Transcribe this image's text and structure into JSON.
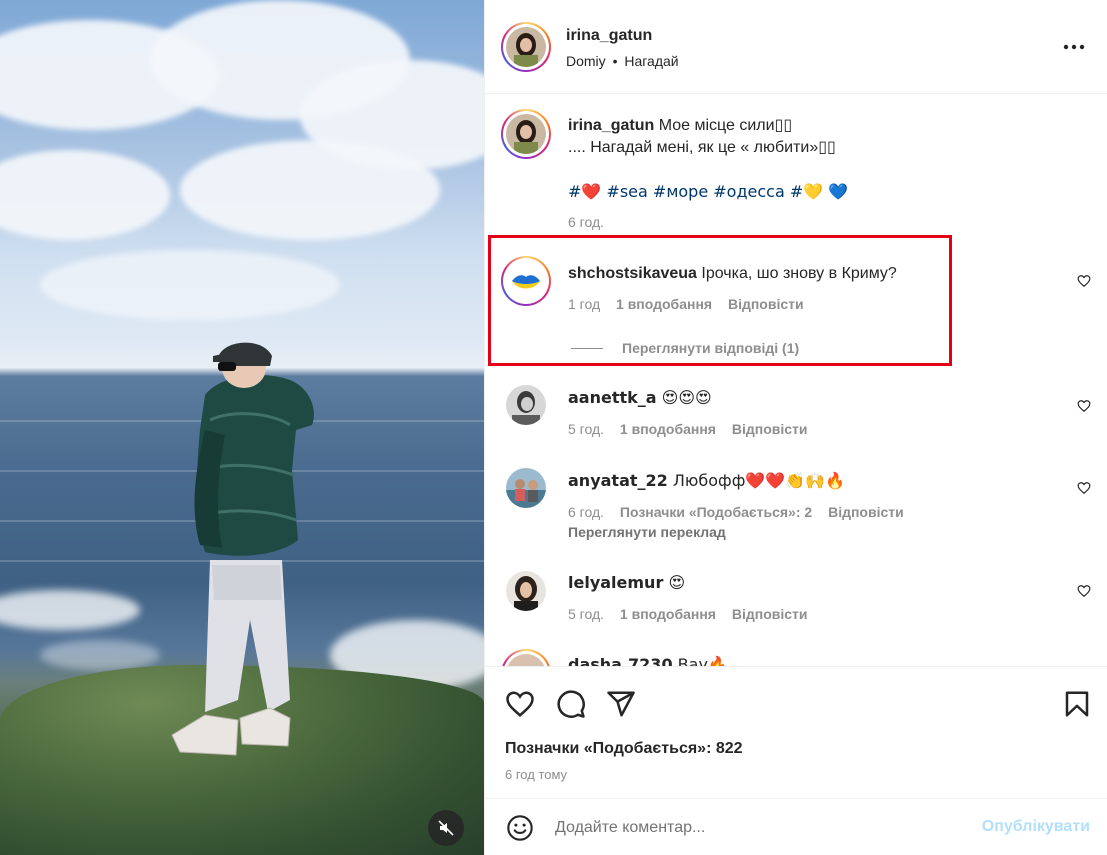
{
  "post": {
    "author": "irina_gatun",
    "location": "Domiy",
    "follow_action": "Нагадай",
    "separator": "•"
  },
  "caption": {
    "author": "irina_gatun",
    "line1": "Мое місце сили▯▯",
    "line2": ".... Нагадай мені, як це « любити»▯▯",
    "hashtags": [
      {
        "text": "#❤️",
        "id": "hash-heart"
      },
      {
        "text": "#sea",
        "id": "hash-sea"
      },
      {
        "text": "#море",
        "id": "hash-more"
      },
      {
        "text": "#одесса",
        "id": "hash-odessa"
      },
      {
        "text": "#💛 💙",
        "id": "hash-flag"
      }
    ],
    "time": "6 год."
  },
  "comments": [
    {
      "user": "shchostsikaveua",
      "text": "Ірочка, шо знову в Криму?",
      "time": "1 год",
      "likes": "1 вподобання",
      "reply": "Відповісти",
      "view_replies": "Переглянути відповіді (1)"
    },
    {
      "user": "aanettk_a",
      "text": "😍😍😍",
      "time": "5 год.",
      "likes": "1 вподобання",
      "reply": "Відповісти"
    },
    {
      "user": "anyatat_22",
      "text": "Любофф❤️❤️👏🙌🔥",
      "time": "6 год.",
      "likes": "Позначки «Подобається»: 2",
      "reply": "Відповісти",
      "translate": "Переглянути переклад"
    },
    {
      "user": "lelyalemur",
      "text": "😍",
      "time": "5 год.",
      "likes": "1 вподобання",
      "reply": "Відповісти"
    },
    {
      "user": "dasha.7230",
      "text": "Вау🔥"
    }
  ],
  "footer": {
    "likes_label": "Позначки «Подобається»: 822",
    "time_ago": "6 год тому",
    "comment_placeholder": "Додайте коментар...",
    "publish_label": "Опублікувати"
  },
  "colors": {
    "accent_link": "#00376b",
    "muted": "#8e8e8e",
    "highlight_border": "#e40017",
    "publish_disabled": "#b2dffc"
  }
}
